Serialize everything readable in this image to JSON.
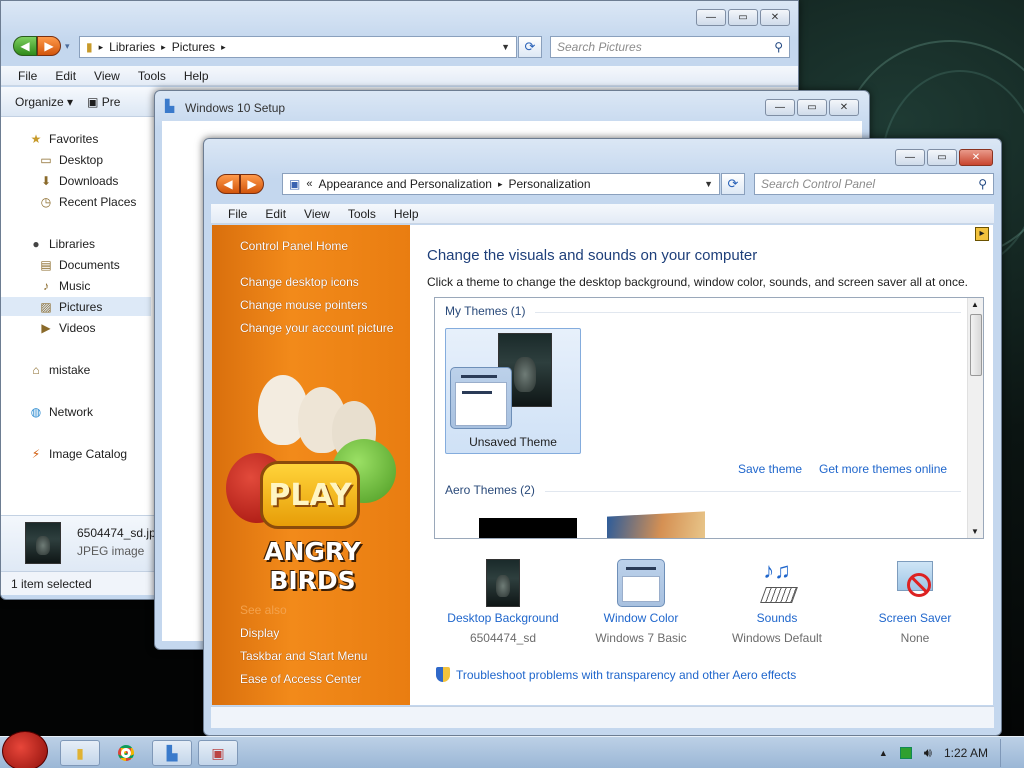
{
  "explorer": {
    "breadcrumb": [
      "Libraries",
      "Pictures"
    ],
    "search_placeholder": "Search Pictures",
    "menu": [
      "File",
      "Edit",
      "View",
      "Tools",
      "Help"
    ],
    "toolbar": {
      "organize": "Organize",
      "preview": "Pre"
    },
    "nav": [
      {
        "label": "Favorites",
        "icon": "star-icon",
        "indent": false
      },
      {
        "label": "Desktop",
        "icon": "desktop-icon",
        "indent": true
      },
      {
        "label": "Downloads",
        "icon": "downloads-icon",
        "indent": true
      },
      {
        "label": "Recent Places",
        "icon": "recent-places-icon",
        "indent": true
      },
      {
        "label": "Libraries",
        "icon": "libraries-icon",
        "indent": false
      },
      {
        "label": "Documents",
        "icon": "documents-icon",
        "indent": true
      },
      {
        "label": "Music",
        "icon": "music-icon",
        "indent": true
      },
      {
        "label": "Pictures",
        "icon": "pictures-icon",
        "indent": true,
        "selected": true
      },
      {
        "label": "Videos",
        "icon": "videos-icon",
        "indent": true
      },
      {
        "label": "mistake",
        "icon": "homegroup-icon",
        "indent": false
      },
      {
        "label": "Network",
        "icon": "network-icon",
        "indent": false
      },
      {
        "label": "Image Catalog",
        "icon": "image-catalog-icon",
        "indent": false
      }
    ],
    "file_name": "6504474_sd.jp",
    "file_type": "JPEG image",
    "status": "1 item selected"
  },
  "setup": {
    "title": "Windows 10 Setup"
  },
  "control_panel": {
    "breadcrumb": [
      "Appearance and Personalization",
      "Personalization"
    ],
    "search_placeholder": "Search Control Panel",
    "menu": [
      "File",
      "Edit",
      "View",
      "Tools",
      "Help"
    ],
    "home_link": "Control Panel Home",
    "task_links": [
      "Change desktop icons",
      "Change mouse pointers",
      "Change your account picture"
    ],
    "see_also_links": [
      "See also",
      "Display",
      "Taskbar and Start Menu",
      "Ease of Access Center"
    ],
    "heading": "Change the visuals and sounds on your computer",
    "subheading": "Click a theme to change the desktop background, window color, sounds, and screen saver all at once.",
    "my_themes_label": "My Themes (1)",
    "unsaved_theme": "Unsaved Theme",
    "save_theme": "Save theme",
    "get_more": "Get more themes online",
    "aero_themes_label": "Aero Themes (2)",
    "bottom_items": [
      {
        "label": "Desktop Background",
        "sub": "6504474_sd",
        "icon": "desktop-background-icon"
      },
      {
        "label": "Window Color",
        "sub": "Windows 7 Basic",
        "icon": "window-color-icon"
      },
      {
        "label": "Sounds",
        "sub": "Windows Default",
        "icon": "sounds-icon"
      },
      {
        "label": "Screen Saver",
        "sub": "None",
        "icon": "screen-saver-icon"
      }
    ],
    "troubleshoot": "Troubleshoot problems with transparency and other Aero effects",
    "banner_play": "PLAY",
    "banner_title": "ANGRY BIRDS"
  },
  "taskbar": {
    "time": "1:22 AM"
  },
  "colors": {
    "accent_orange": "#f08a1c",
    "link_blue": "#1f66cc"
  }
}
